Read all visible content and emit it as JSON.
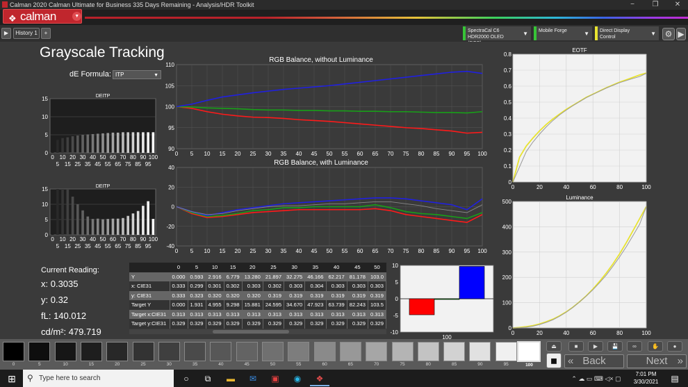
{
  "window": {
    "title": "Calman 2020 Calman Ultimate for Business 335 Days Remaining  - Analysis/HDR Toolkit",
    "minimize": "−",
    "maximize": "❐",
    "close": "✕"
  },
  "logo": {
    "text": "calman",
    "mark": "❖"
  },
  "tabs": {
    "back": "▶",
    "history_label": "History 1",
    "add": "+"
  },
  "devices": [
    {
      "label": "SpectraCal C6 HDR2000 OLED (RGB)",
      "accent": "#37c437"
    },
    {
      "label": "Mobile Forge",
      "accent": "#37c437"
    },
    {
      "label": "Direct Display Control",
      "accent": "#e8e330"
    }
  ],
  "page": {
    "title": "Grayscale Tracking",
    "de_formula_label": "dE Formula:",
    "de_formula_value": "ITP"
  },
  "charts": {
    "deitp1_title": "DEITP",
    "deitp2_title": "DEITP",
    "rgb_nolum_title": "RGB Balance, without Luminance",
    "rgb_lum_title": "RGB Balance, with Luminance",
    "eotf_title": "EOTF",
    "luminance_title": "Luminance",
    "balance_bar_label": "100"
  },
  "chart_data": [
    {
      "type": "bar",
      "title": "DEITP",
      "categories": [
        0,
        5,
        10,
        15,
        20,
        25,
        30,
        35,
        40,
        45,
        50,
        55,
        60,
        65,
        70,
        75,
        80,
        85,
        90,
        95,
        100
      ],
      "xticks_top": [
        "0",
        "10",
        "20",
        "30",
        "40",
        "50",
        "60",
        "70",
        "80",
        "90",
        "100"
      ],
      "xticks_bottom": [
        "5",
        "15",
        "25",
        "35",
        "45",
        "55",
        "65",
        "75",
        "85",
        "95"
      ],
      "ylim": [
        0,
        15
      ],
      "yticks": [
        "0",
        "5",
        "10",
        "15"
      ],
      "values": [
        0.3,
        3.6,
        4.1,
        4.3,
        4.6,
        4.8,
        5.0,
        5.1,
        5.2,
        5.3,
        5.4,
        5.5,
        5.6,
        5.6,
        5.7,
        5.7,
        5.7,
        5.7,
        5.7,
        5.7,
        5.7
      ]
    },
    {
      "type": "bar",
      "title": "DEITP",
      "categories": [
        0,
        5,
        10,
        15,
        20,
        25,
        30,
        35,
        40,
        45,
        50,
        55,
        60,
        65,
        70,
        75,
        80,
        85,
        90,
        95,
        100
      ],
      "xticks_top": [
        "0",
        "10",
        "20",
        "30",
        "40",
        "50",
        "60",
        "70",
        "80",
        "90",
        "100"
      ],
      "xticks_bottom": [
        "5",
        "15",
        "25",
        "35",
        "45",
        "55",
        "65",
        "75",
        "85",
        "95"
      ],
      "ylim": [
        0,
        15
      ],
      "yticks": [
        "0",
        "5",
        "10",
        "15"
      ],
      "values": [
        0.5,
        15,
        15,
        15,
        12.5,
        10,
        8,
        6,
        5.2,
        5.3,
        5.1,
        5.2,
        5.3,
        5.3,
        5.5,
        6.2,
        7.0,
        7.8,
        9.5,
        11,
        5.2
      ]
    },
    {
      "type": "line",
      "title": "RGB Balance, without Luminance",
      "x": [
        0,
        5,
        10,
        15,
        20,
        25,
        30,
        35,
        40,
        45,
        50,
        55,
        60,
        65,
        70,
        75,
        80,
        85,
        90,
        95,
        100
      ],
      "xticks": [
        "0",
        "5",
        "10",
        "15",
        "20",
        "25",
        "30",
        "35",
        "40",
        "45",
        "50",
        "55",
        "60",
        "65",
        "70",
        "75",
        "80",
        "85",
        "90",
        "95",
        "100"
      ],
      "ylim": [
        90,
        110
      ],
      "yticks": [
        "90",
        "95",
        "100",
        "105",
        "110"
      ],
      "series": [
        {
          "color": "#ff1a1a",
          "values": [
            100,
            99.6,
            98.8,
            98.2,
            97.8,
            97.5,
            97.4,
            97.2,
            96.9,
            96.7,
            96.5,
            96.2,
            95.9,
            95.6,
            95.3,
            95.0,
            94.8,
            94.5,
            94.2,
            93.7,
            93.9
          ]
        },
        {
          "color": "#18a018",
          "values": [
            100,
            99.9,
            99.7,
            99.6,
            99.5,
            99.3,
            99.2,
            99.2,
            99.1,
            99.1,
            99.0,
            99.0,
            98.9,
            98.9,
            98.8,
            98.8,
            98.7,
            98.6,
            98.6,
            98.5,
            98.8
          ]
        },
        {
          "color": "#2020e0",
          "values": [
            100,
            100.6,
            101.5,
            102.3,
            102.8,
            103.3,
            103.7,
            104.1,
            104.4,
            104.7,
            105.0,
            105.4,
            105.8,
            106.2,
            106.6,
            107.0,
            107.4,
            107.8,
            108.2,
            108.4,
            107.9
          ]
        }
      ]
    },
    {
      "type": "line",
      "title": "RGB Balance, with Luminance",
      "x": [
        0,
        5,
        10,
        15,
        20,
        25,
        30,
        35,
        40,
        45,
        50,
        55,
        60,
        65,
        70,
        75,
        80,
        85,
        90,
        95,
        100
      ],
      "xticks": [
        "0",
        "5",
        "10",
        "15",
        "20",
        "25",
        "30",
        "35",
        "40",
        "45",
        "50",
        "55",
        "60",
        "65",
        "70",
        "75",
        "80",
        "85",
        "90",
        "95",
        "100"
      ],
      "ylim": [
        -40,
        40
      ],
      "yticks": [
        "-40",
        "-20",
        "0",
        "20",
        "40"
      ],
      "series": [
        {
          "color": "#ff1a1a",
          "values": [
            0,
            -7,
            -11,
            -10,
            -8,
            -6,
            -5,
            -4,
            -3,
            -3,
            -3,
            -3,
            -3,
            -2,
            -4,
            -8,
            -10,
            -12,
            -14,
            -16,
            -8
          ]
        },
        {
          "color": "#18a018",
          "values": [
            0,
            -6,
            -10,
            -9,
            -7,
            -4,
            -3,
            -1,
            -1,
            0,
            0,
            0,
            0,
            2,
            -1,
            -5,
            -7,
            -8,
            -10,
            -12,
            -6
          ]
        },
        {
          "color": "#2020e0",
          "values": [
            0,
            -5,
            -9,
            -6,
            -3,
            -1,
            1,
            3,
            4,
            5,
            6,
            7,
            8,
            9,
            9,
            8,
            6,
            4,
            2,
            -3,
            8
          ]
        },
        {
          "color": "#888888",
          "values": [
            0,
            -5,
            -8,
            -7,
            -4,
            -2,
            0,
            1,
            1,
            2,
            3,
            3,
            4,
            5,
            5,
            3,
            1,
            -2,
            -4,
            -6,
            2
          ]
        }
      ]
    },
    {
      "type": "line",
      "title": "EOTF",
      "x": [
        0,
        5,
        10,
        15,
        20,
        25,
        30,
        35,
        40,
        45,
        50,
        55,
        60,
        65,
        70,
        75,
        80,
        85,
        90,
        95,
        100
      ],
      "xticks": [
        "0",
        "20",
        "40",
        "60",
        "80",
        "100"
      ],
      "ylim": [
        0,
        0.8
      ],
      "yticks": [
        "0",
        "0.1",
        "0.2",
        "0.3",
        "0.4",
        "0.5",
        "0.6",
        "0.7",
        "0.8"
      ],
      "series": [
        {
          "color": "#e8e330",
          "values": [
            0,
            0.155,
            0.225,
            0.275,
            0.32,
            0.36,
            0.395,
            0.425,
            0.455,
            0.48,
            0.505,
            0.53,
            0.55,
            0.57,
            0.59,
            0.608,
            0.625,
            0.64,
            0.655,
            0.67,
            0.682
          ]
        },
        {
          "color": "#999999",
          "values": [
            0,
            0.095,
            0.19,
            0.25,
            0.3,
            0.345,
            0.385,
            0.42,
            0.45,
            0.478,
            0.503,
            0.528,
            0.548,
            0.568,
            0.588,
            0.605,
            0.622,
            0.635,
            0.648,
            0.66,
            0.68
          ]
        }
      ]
    },
    {
      "type": "line",
      "title": "Luminance",
      "x": [
        0,
        5,
        10,
        15,
        20,
        25,
        30,
        35,
        40,
        45,
        50,
        55,
        60,
        65,
        70,
        75,
        80,
        85,
        90,
        95,
        100
      ],
      "xticks": [
        "0",
        "20",
        "40",
        "60",
        "80",
        "100"
      ],
      "ylim": [
        0,
        500
      ],
      "yticks": [
        "0",
        "100",
        "200",
        "300",
        "400",
        "500"
      ],
      "series": [
        {
          "color": "#e8e330",
          "values": [
            0,
            1.9,
            5.0,
            9.3,
            15.9,
            24.6,
            34.7,
            47.9,
            63.7,
            82.2,
            103.5,
            127,
            154,
            184,
            217,
            253,
            293,
            337,
            384,
            432,
            480
          ]
        },
        {
          "color": "#999999",
          "values": [
            0,
            0.6,
            2.9,
            6.8,
            13.3,
            21.9,
            32.3,
            46.2,
            62.2,
            81.2,
            103,
            126,
            151,
            179,
            209,
            244,
            281,
            321,
            365,
            410,
            480
          ]
        }
      ]
    },
    {
      "type": "bar",
      "title": "",
      "categories": [
        "R",
        "G",
        "B"
      ],
      "ylim": [
        -10,
        10
      ],
      "yticks": [
        "-10",
        "-5",
        "0",
        "5",
        "10"
      ],
      "xlabel": "100",
      "values": [
        -4.8,
        -0.2,
        9.7
      ],
      "colors": [
        "#ff0000",
        "#00a000",
        "#0000ff"
      ]
    }
  ],
  "reading": {
    "title": "Current Reading:",
    "x": "x: 0.3035",
    "y": "y: 0.32",
    "fl": "fL: 140.012",
    "cdm2": "cd/m²: 479.719"
  },
  "table": {
    "columns": [
      "",
      "0",
      "5",
      "10",
      "15",
      "20",
      "25",
      "30",
      "35",
      "40",
      "45",
      "50"
    ],
    "rows": [
      [
        "Y",
        "0.000",
        "0.593",
        "2.916",
        "6.779",
        "13.280",
        "21.897",
        "32.275",
        "46.166",
        "62.217",
        "81.178",
        "103.0"
      ],
      [
        "x: CIE31",
        "0.333",
        "0.299",
        "0.301",
        "0.302",
        "0.303",
        "0.302",
        "0.303",
        "0.304",
        "0.303",
        "0.303",
        "0.303"
      ],
      [
        "y: CIE31",
        "0.333",
        "0.323",
        "0.320",
        "0.320",
        "0.320",
        "0.319",
        "0.319",
        "0.319",
        "0.319",
        "0.319",
        "0.319"
      ],
      [
        "Target Y",
        "0.000",
        "1.931",
        "4.955",
        "9.298",
        "15.881",
        "24.595",
        "34.670",
        "47.923",
        "63.739",
        "82.243",
        "103.5"
      ],
      [
        "Target x:CIE31",
        "0.313",
        "0.313",
        "0.313",
        "0.313",
        "0.313",
        "0.313",
        "0.313",
        "0.313",
        "0.313",
        "0.313",
        "0.313"
      ],
      [
        "Target y:CIE31",
        "0.329",
        "0.329",
        "0.329",
        "0.329",
        "0.329",
        "0.329",
        "0.329",
        "0.329",
        "0.329",
        "0.329",
        "0.329"
      ]
    ]
  },
  "swatches": {
    "labels": [
      "0",
      "5",
      "10",
      "15",
      "20",
      "25",
      "30",
      "35",
      "40",
      "45",
      "50",
      "55",
      "60",
      "65",
      "70",
      "75",
      "80",
      "85",
      "90",
      "95"
    ],
    "colors": [
      "#000000",
      "#0e0e0e",
      "#161616",
      "#1e1e1e",
      "#282828",
      "#333333",
      "#3f3f3f",
      "#4a4a4a",
      "#575757",
      "#636363",
      "#707070",
      "#7d7d7d",
      "#8a8a8a",
      "#989898",
      "#a6a6a6",
      "#b4b4b4",
      "#c3c3c3",
      "#d2d2d2",
      "#e1e1e1",
      "#f0f0f0"
    ],
    "current_label": "100"
  },
  "controls": {
    "eject": "⏏",
    "stop": "■",
    "play": "▶",
    "save": "💾",
    "loop": "∞",
    "hand": "✋",
    "circle": "●",
    "stop_square": "◼"
  },
  "nav": {
    "back": "Back",
    "next": "Next",
    "back_arrows": "«",
    "next_arrows": "»"
  },
  "taskbar": {
    "start": "⊞",
    "search_placeholder": "Type here to search",
    "search_icon": "⚲",
    "time": "7:01 PM",
    "date": "3/30/2021",
    "tray": "⌃ ☁ ▭ ⌨ ◁× ▢"
  }
}
